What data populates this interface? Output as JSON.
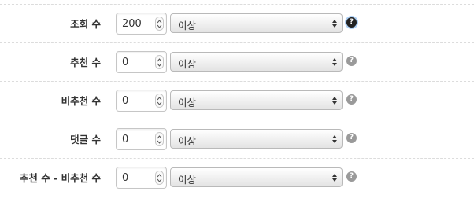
{
  "rows": [
    {
      "label": "조회 수",
      "value": "200",
      "operator": "이상",
      "help_active": true
    },
    {
      "label": "추천 수",
      "value": "0",
      "operator": "이상",
      "help_active": false
    },
    {
      "label": "비추천 수",
      "value": "0",
      "operator": "이상",
      "help_active": false
    },
    {
      "label": "댓글 수",
      "value": "0",
      "operator": "이상",
      "help_active": false
    },
    {
      "label": "추천 수 - 비추천 수",
      "value": "0",
      "operator": "이상",
      "help_active": false
    }
  ],
  "help_glyph": "?",
  "icons": {
    "stepper": "up-down-spin-icon",
    "select": "updown-arrows-icon",
    "help": "question-circle-icon"
  },
  "colors": {
    "help_active": "#222222",
    "help_inactive": "#9a9a9a",
    "focus_ring": "#aed0f5"
  }
}
